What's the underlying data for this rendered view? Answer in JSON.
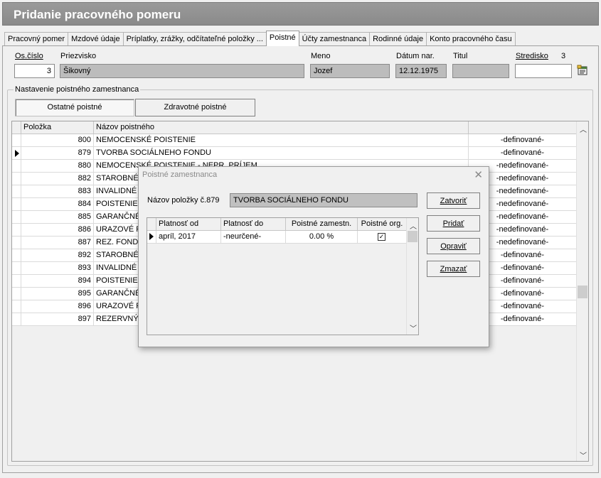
{
  "window": {
    "title": "Pridanie pracovného pomeru"
  },
  "tabs": [
    {
      "label": "Pracovný pomer"
    },
    {
      "label": "Mzdové údaje"
    },
    {
      "label": "Príplatky, zrážky, odčítateľné položky ..."
    },
    {
      "label": "Poistné"
    },
    {
      "label": "Účty zamestnanca"
    },
    {
      "label": "Rodinné údaje"
    },
    {
      "label": "Konto pracovného času"
    }
  ],
  "employee": {
    "oscislo_label": "Os.číslo",
    "oscislo_value": "3",
    "priezvisko_label": "Priezvisko",
    "priezvisko_value": "Šikovný",
    "meno_label": "Meno",
    "meno_value": "Jozef",
    "datum_label": "Dátum nar.",
    "datum_value": "12.12.1975",
    "titul_label": "Titul",
    "titul_value": "",
    "stredisko_label": "Stredisko",
    "stredisko_number": "3",
    "stredisko_value": ""
  },
  "group": {
    "title": "Nastavenie poistného zamestnanca",
    "buttons": [
      "Ostatné poistné",
      "Zdravotné poistné"
    ]
  },
  "grid": {
    "columns": [
      "Položka",
      "Názov poistného",
      ""
    ],
    "rows": [
      {
        "code": "800",
        "name": "NEMOCENSKÉ POISTENIE",
        "status": "-definované-"
      },
      {
        "code": "879",
        "name": "TVORBA SOCIÁLNEHO FONDU",
        "status": "-definované-"
      },
      {
        "code": "880",
        "name": "NEMOCENSKÉ POISTENIE - NEPR. PRÍJEM",
        "status": "-nedefinované-"
      },
      {
        "code": "882",
        "name": "STAROBNÉ",
        "status": "-nedefinované-"
      },
      {
        "code": "883",
        "name": "INVALIDNÉ",
        "status": "-nedefinované-"
      },
      {
        "code": "884",
        "name": "POISTENIE V",
        "status": "-nedefinované-"
      },
      {
        "code": "885",
        "name": "GARANČNÉ",
        "status": "-nedefinované-"
      },
      {
        "code": "886",
        "name": "URAZOVÉ P",
        "status": "-nedefinované-"
      },
      {
        "code": "887",
        "name": "REZ. FOND",
        "status": "-nedefinované-"
      },
      {
        "code": "892",
        "name": "STAROBNÉ",
        "status": "-definované-"
      },
      {
        "code": "893",
        "name": "INVALIDNÉ",
        "status": "-definované-"
      },
      {
        "code": "894",
        "name": "POISTENIE V",
        "status": "-definované-"
      },
      {
        "code": "895",
        "name": "GARANČNÉ",
        "status": "-definované-"
      },
      {
        "code": "896",
        "name": "URAZOVÉ P",
        "status": "-definované-"
      },
      {
        "code": "897",
        "name": "REZERVNÝ",
        "status": "-definované-"
      }
    ]
  },
  "dialog": {
    "title": "Poistné zamestnanca",
    "close_icon": "close-icon",
    "item_label": "Názov položky č.879",
    "item_value": "TVORBA SOCIÁLNEHO FONDU",
    "columns": [
      "Platnosť od",
      "Platnosť do",
      "Poistné  zamestn.",
      "Poistné org."
    ],
    "rows": [
      {
        "from": "apríl, 2017",
        "to": "-neurčené-",
        "rate": "0.00 %",
        "org_checked": true
      }
    ],
    "buttons": {
      "close": "Zatvoriť",
      "add": "Pridať",
      "edit": "Opraviť",
      "delete": "Zmazať"
    }
  }
}
